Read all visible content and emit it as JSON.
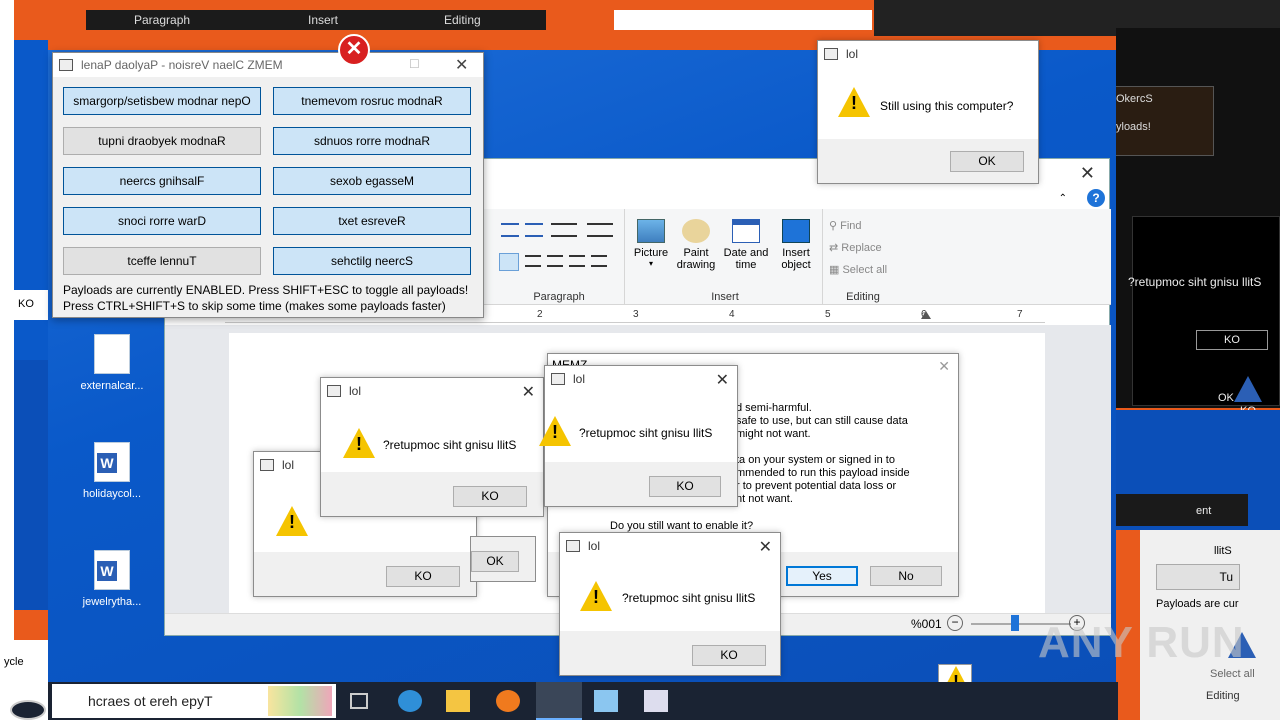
{
  "top_ribbon_fragment": {
    "paragraph": "Paragraph",
    "insert": "Insert",
    "editing": "Editing"
  },
  "control_panel": {
    "title": "lenaP daolyaP - noisreV naelC ZMEM",
    "buttons": [
      {
        "label": "smargorp/setisbew modnar nepO",
        "active": true
      },
      {
        "label": "tnemevom rosruc modnaR",
        "active": true
      },
      {
        "label": "tupni draobyek modnaR",
        "active": false
      },
      {
        "label": "sdnuos rorre modnaR",
        "active": true
      },
      {
        "label": "neercs gnihsalF",
        "active": true
      },
      {
        "label": "sexob egasseM",
        "active": true
      },
      {
        "label": "snoci rorre warD",
        "active": true
      },
      {
        "label": "txet esreveR",
        "active": true
      },
      {
        "label": "tceffe lennuT",
        "active": false
      },
      {
        "label": "sehctilg neercS",
        "active": true
      }
    ],
    "note1": "Payloads are currently ENABLED. Press SHIFT+ESC to toggle all payloads!",
    "note2": "Press CTRL+SHIFT+S to skip some time (makes some payloads faster)"
  },
  "lol_top": {
    "title": "lol",
    "message": "Still using this computer?",
    "ok": "OK"
  },
  "wordpad": {
    "groups": {
      "paragraph": "Paragraph",
      "insert": "Insert",
      "editing": "Editing"
    },
    "insert_items": [
      "Picture",
      "Paint drawing",
      "Date and time",
      "Insert object"
    ],
    "editing_items": [
      "Find",
      "Replace",
      "Select all"
    ],
    "ruler_numbers": [
      "2",
      "3",
      "4",
      "5",
      "6",
      "7"
    ],
    "zoom": "%001"
  },
  "memz_dialog": {
    "title": "MEMZ",
    "lines": [
      "d semi-harmful.",
      "safe to use, but can still cause data",
      "might not want.",
      "",
      "ta on your system or signed in to",
      "mmended to run this payload inside",
      "r to prevent potential data loss or",
      "nt not want."
    ],
    "question": "Do you still want to enable it?",
    "yes": "Yes",
    "no": "No"
  },
  "lol_dialogs": [
    {
      "title": "lol",
      "message": "?retupmoc siht gnisu llitS",
      "ok": "KO"
    },
    {
      "title": "lol",
      "message": "?retupmoc siht gnisu llitS",
      "ok": "KO"
    },
    {
      "title": "lol",
      "message": "?retupmoc siht gnisu llitS",
      "ok": "KO"
    },
    {
      "title": "lol",
      "message": "",
      "ok": "KO"
    }
  ],
  "right_fragments": {
    "still_using": "?retupmoc siht gnisu llitS",
    "ko": "KO",
    "ko2": "KO",
    "ok": "OK",
    "payloads": "yloads!",
    "payloads_cur": "Payloads are cur",
    "select_all": "Select all",
    "editing": "Editing",
    "ent": "ent",
    "llits": "llitS",
    "tu": "Tu",
    "okercs": "OkercS"
  },
  "left_fragments": {
    "ko": "KO",
    "recycle": "ycle"
  },
  "desktop_icons": [
    {
      "label": "externalcar..."
    },
    {
      "label": "holidaycol..."
    },
    {
      "label": "jewelrytha..."
    }
  ],
  "taskbar": {
    "search_placeholder": "hcraes ot ereh epyT"
  },
  "watermark": "ANY RUN",
  "colors": {
    "accent": "#0078d7",
    "warning": "#f5c400",
    "button_active": "#cce4f7"
  }
}
